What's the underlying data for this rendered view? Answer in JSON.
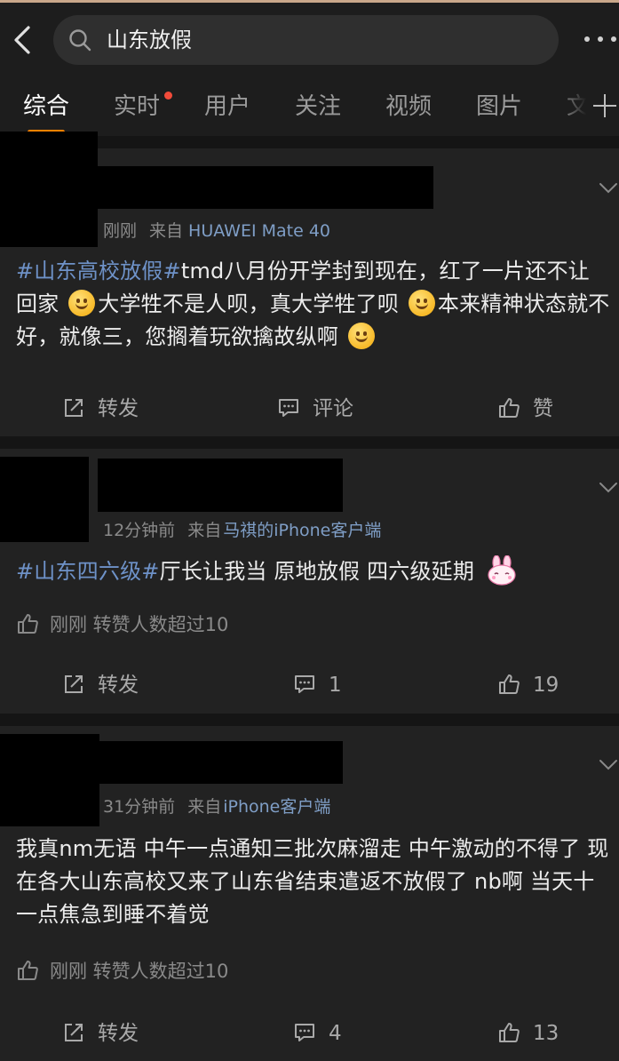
{
  "search": {
    "query": "山东放假"
  },
  "tabs": [
    "综合",
    "实时",
    "用户",
    "关注",
    "视频",
    "图片",
    "文"
  ],
  "posts": [
    {
      "time": "刚刚",
      "from_label": "来自",
      "source": "HUAWEI Mate 40",
      "tag": "#山东高校放假#",
      "text_1": "tmd八月份开学封到现在，红了一片还不让回家",
      "text_2": "大学牲不是人呗，真大学牲了呗",
      "text_3": "本来精神状态就不好，就像三，您搁着玩欲擒故纵啊",
      "forward": "转发",
      "comment": "评论",
      "like": "赞"
    },
    {
      "time": "12分钟前",
      "from_label": "来自",
      "source": "马祺的iPhone客户端",
      "tag": "#山东四六级#",
      "text_1": "厅长让我当 原地放假 四六级延期",
      "like_info": "刚刚 转赞人数超过10",
      "forward": "转发",
      "comment": "1",
      "like": "19"
    },
    {
      "time": "31分钟前",
      "from_label": "来自",
      "source": "iPhone客户端",
      "text_1": "我真nm无语 中午一点通知三批次麻溜走 中午激动的不得了 现在各大山东高校又来了山东省结束遣返不放假了 nb啊 当天十一点焦急到睡不着觉",
      "like_info": "刚刚 转赞人数超过10",
      "forward": "转发",
      "comment": "4",
      "like": "13"
    }
  ],
  "icons": [
    "back-arrow-icon",
    "search-icon",
    "more-icon",
    "add-tab-icon",
    "chevron-down-icon",
    "forward-icon",
    "comment-icon",
    "thumbs-up-icon",
    "smile-emoji-icon",
    "bunny-emoji-icon"
  ],
  "colors": {
    "accent": "#ff8200",
    "link": "#6e92c8",
    "background": "#1a1a1a",
    "badge": "#f24b3a"
  }
}
